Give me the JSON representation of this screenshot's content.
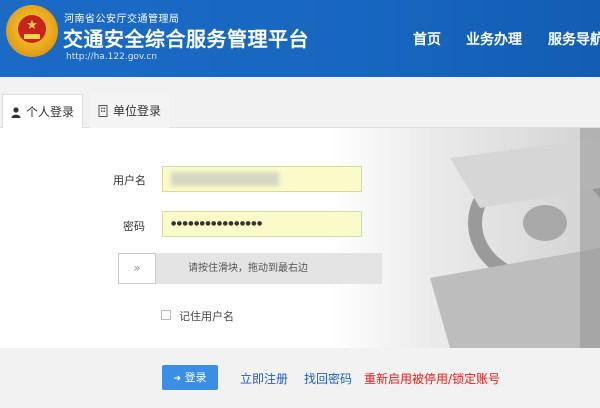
{
  "header": {
    "subtitle": "河南省公安厅交通管理局",
    "title": "交通安全综合服务管理平台",
    "url": "http://ha.122.gov.cn",
    "nav": [
      "首页",
      "业务办理",
      "服务导航"
    ]
  },
  "tabs": [
    {
      "label": "个人登录",
      "icon": "user-icon",
      "active": true
    },
    {
      "label": "单位登录",
      "icon": "building-icon",
      "active": false
    }
  ],
  "form": {
    "username_label": "用户名",
    "username_value": "",
    "password_label": "密码",
    "password_value": "●●●●●●●●●●●●●●●●",
    "slider_handle": "»",
    "slider_text": "请按住滑块，拖动到最右边",
    "remember_label": "记住用户名"
  },
  "actions": {
    "login": "登录",
    "register": "立即注册",
    "recover": "找回密码",
    "reactivate": "重新启用被停用/锁定账号"
  },
  "colors": {
    "header": "#1766bf",
    "button": "#3a8ee6",
    "link": "#1f5fb5",
    "warning_link": "#e02020",
    "input_bg": "#fafbc8"
  }
}
